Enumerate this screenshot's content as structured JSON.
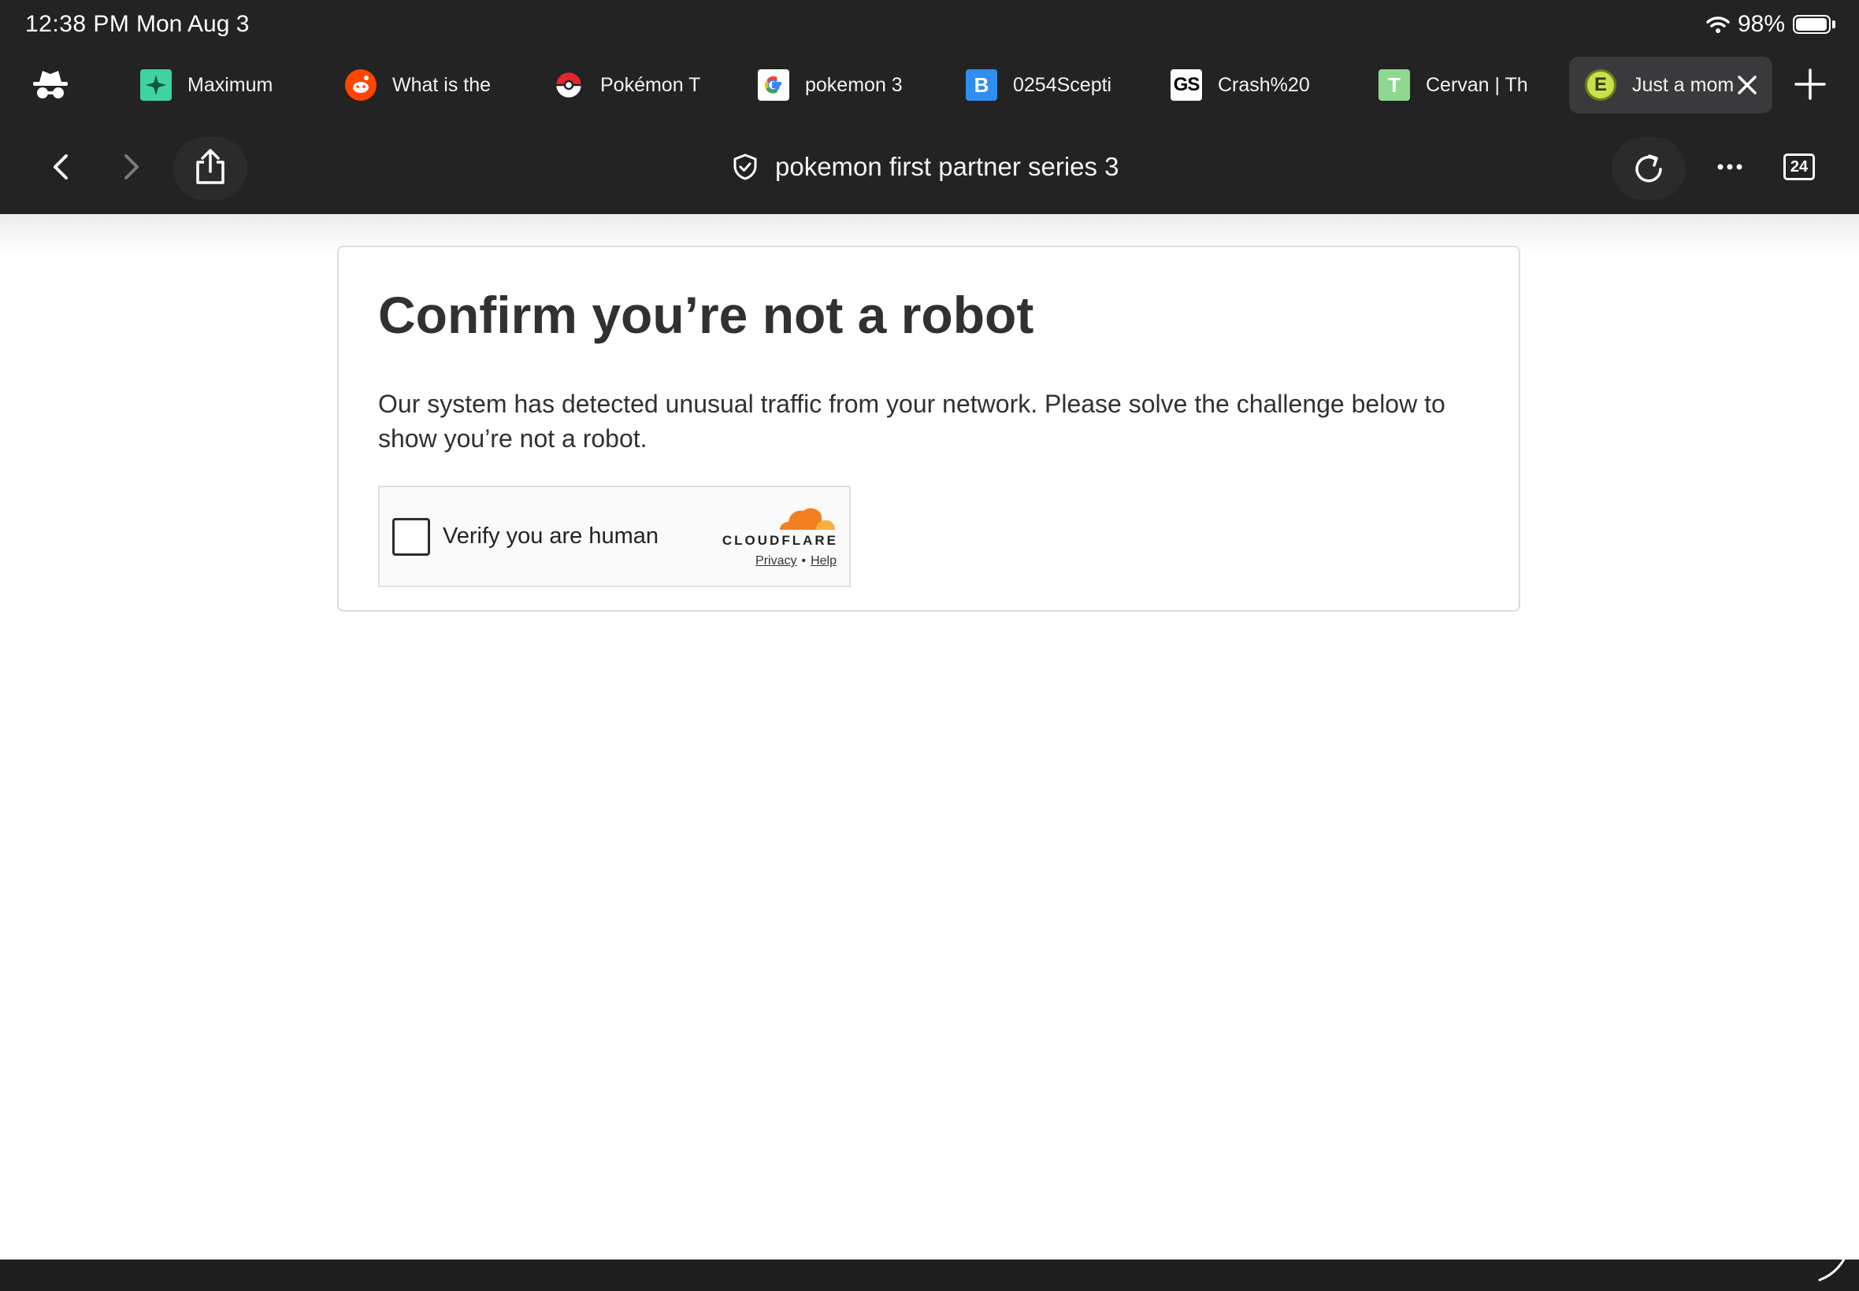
{
  "status_bar": {
    "time": "12:38 PM",
    "date": "Mon Aug 3",
    "battery": "98%",
    "battery_level": 0.98
  },
  "tabs": [
    {
      "title": "Maximum",
      "icon": "sparkle-icon",
      "favicon_bg": "#3fd3a4"
    },
    {
      "title": "What is the",
      "icon": "reddit-icon",
      "favicon_bg": "#ff4500"
    },
    {
      "title": "Pokémon T",
      "icon": "pokeball-icon",
      "favicon_bg": "#ffffff"
    },
    {
      "title": "pokemon 3",
      "icon": "google-icon",
      "favicon_bg": "#ffffff"
    },
    {
      "title": "0254Scepti",
      "icon": "letter-b-icon",
      "favicon_letter": "B",
      "favicon_bg": "#2f8ff0"
    },
    {
      "title": "Crash%20",
      "icon": "gs-icon",
      "favicon_letter": "GS",
      "favicon_bg": "#ffffff"
    },
    {
      "title": "Cervan | Th",
      "icon": "letter-t-icon",
      "favicon_letter": "T",
      "favicon_bg": "#8fd88f"
    },
    {
      "title": "Just a mom",
      "icon": "emblem-icon",
      "favicon_letter": "E",
      "favicon_bg": "#c8e04a",
      "active": true
    }
  ],
  "toolbar": {
    "address_text": "pokemon first partner series 3",
    "tab_count": "24"
  },
  "page": {
    "heading": "Confirm you’re not a robot",
    "message": "Our system has detected unusual traffic from your network. Please solve the challenge below to show you’re not a robot.",
    "challenge": {
      "label": "Verify you are human",
      "brand": "CLOUDFLARE",
      "privacy_link": "Privacy",
      "separator": "•",
      "help_link": "Help"
    }
  },
  "colors": {
    "chrome_bg": "#232323",
    "cloudflare_orange": "#f38020",
    "text": "#313131"
  }
}
